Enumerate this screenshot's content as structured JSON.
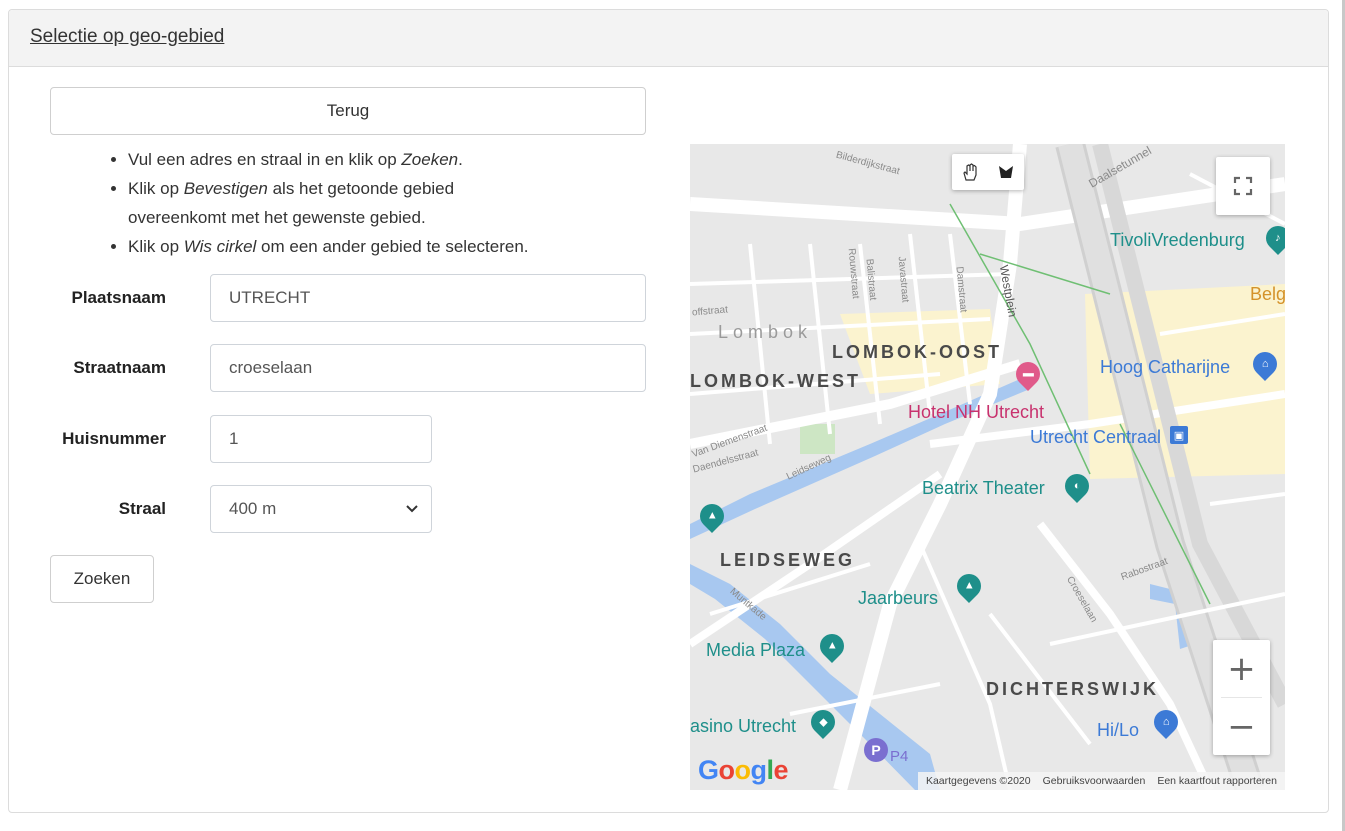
{
  "header": {
    "title": "Selectie op geo-gebied"
  },
  "back_button": "Terug",
  "instructions": [
    {
      "pre": "Vul een adres en straal in en klik op ",
      "em": "Zoeken",
      "post": "."
    },
    {
      "pre": "Klik op ",
      "em": "Bevestigen",
      "post": " als het getoonde gebied overeenkomt met het gewenste gebied."
    },
    {
      "pre": "Klik op ",
      "em": "Wis cirkel",
      "post": " om een ander gebied te selecteren."
    }
  ],
  "form": {
    "plaatsnaam": {
      "label": "Plaatsnaam",
      "value": "UTRECHT"
    },
    "straatnaam": {
      "label": "Straatnaam",
      "value": "croeselaan"
    },
    "huisnummer": {
      "label": "Huisnummer",
      "value": "1"
    },
    "straal": {
      "label": "Straal",
      "value": "400 m"
    }
  },
  "search_button": "Zoeken",
  "map": {
    "areas": {
      "lombok": "Lombok",
      "lombok_oost": "LOMBOK-OOST",
      "lombok_west": "LOMBOK-WEST",
      "leidseweg": "LEIDSEWEG",
      "dichterswijk": "DICHTERSWIJK"
    },
    "pois": {
      "tivoli": "TivoliVredenburg",
      "hoog_catharijne": "Hoog Catharijne",
      "hotel_nh": "Hotel NH Utrecht",
      "utrecht_centraal": "Utrecht Centraal",
      "beatrix": "Beatrix Theater",
      "jaarbeurs": "Jaarbeurs",
      "media_plaza": "Media Plaza",
      "casino": "asino Utrecht",
      "hilo": "Hi/Lo",
      "p4": "P4",
      "belg": "Belg"
    },
    "streets": {
      "bilderdijk": "Bilderdijkstraat",
      "daalsetunnel": "Daalsetunnel",
      "westplein": "Westplein",
      "damstraat": "Damstraat",
      "javastraat": "Javastraat",
      "balistraat": "Balistraat",
      "rouwstraat": "Rouwstraat",
      "offstraat": "offstraat",
      "van_diemen": "Van Diemenstraat",
      "daendels": "Daendelsstraat",
      "leidseweg": "Leidseweg",
      "muntkade": "Muntkade",
      "croeselaan": "Croeselaan",
      "rabostraat": "Rabostraat"
    },
    "google_logo": "Google",
    "attribution": {
      "data": "Kaartgegevens ©2020",
      "terms": "Gebruiksvoorwaarden",
      "report": "Een kaartfout rapporteren"
    },
    "zoom_in": "+",
    "zoom_out": "−"
  },
  "colors": {
    "map_bg": "#e8e8e8",
    "road": "#ffffff",
    "water": "#a8c8f0",
    "commercial": "#fbf3cf",
    "poi_teal": "#1e8f8a",
    "poi_blue": "#3c7ad6",
    "poi_pink": "#c8326e"
  },
  "icons": {
    "pan": "hand-icon",
    "draw": "draw-shape-icon",
    "fullscreen": "fullscreen-icon",
    "select_chevron": "chevron-down-icon"
  }
}
